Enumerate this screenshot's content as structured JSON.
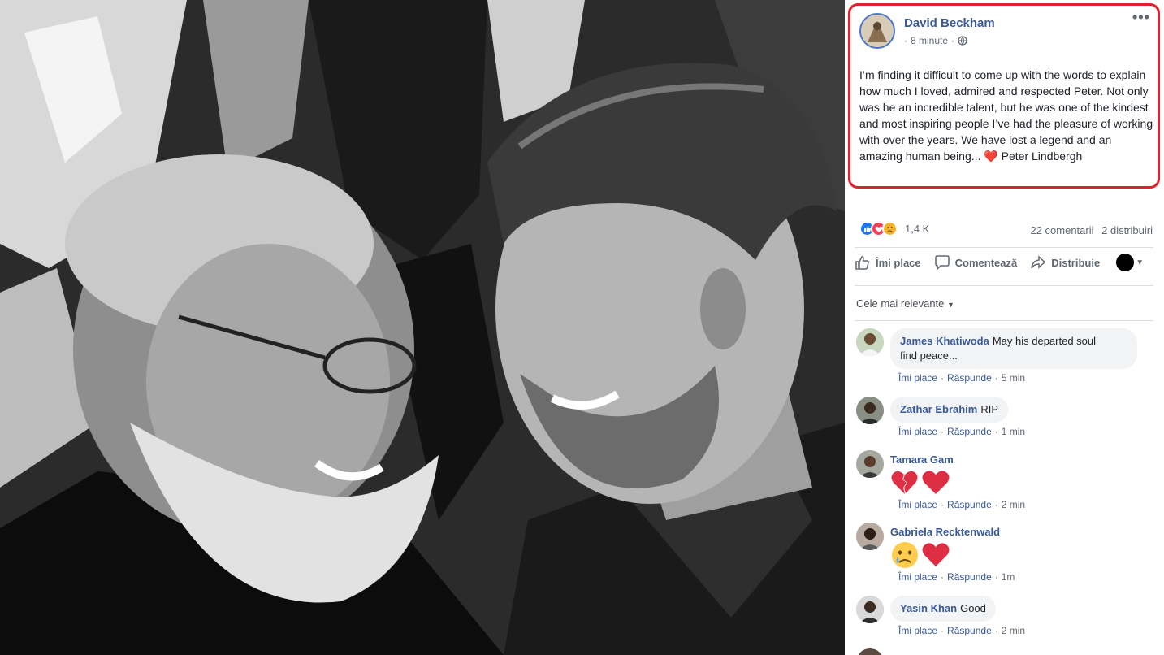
{
  "post": {
    "author": "David Beckham",
    "time": "8 minute",
    "dot": "·",
    "text_before_heart": "I’m finding it difficult to come up with the words to explain how much I loved, admired and respected Peter. Not only was he an incredible talent, but he was one of the kindest and most inspiring people I’ve had the pleasure of working with over the years. We have lost a legend and an amazing human being... ",
    "heart": "❤️",
    "text_after_heart": " Peter Lindbergh",
    "more_icon": "•••"
  },
  "reactions": {
    "count": "1,4 K",
    "comments": "22 comentarii",
    "shares": "2 distribuiri",
    "icons": [
      "like-icon",
      "love-icon",
      "sad-icon"
    ]
  },
  "actions": {
    "like": "Îmi place",
    "comment": "Comentează",
    "share": "Distribuie"
  },
  "sort_label": "Cele mai relevante",
  "comments": [
    {
      "name": "James Khatiwoda",
      "text": "May his departed soul",
      "text2": "find peace...",
      "like": "Îmi place",
      "reply": "Răspunde",
      "time": "5 min"
    },
    {
      "name": "Zathar Ebrahim",
      "text": "RIP",
      "like": "Îmi place",
      "reply": "Răspunde",
      "time": "1 min"
    },
    {
      "name": "Tamara Gam",
      "emojis": [
        "broken-heart-icon",
        "red-heart-icon"
      ],
      "like": "Îmi place",
      "reply": "Răspunde",
      "time": "2 min"
    },
    {
      "name": "Gabriela Recktenwald",
      "emojis": [
        "crying-face-icon",
        "red-heart-icon"
      ],
      "like": "Îmi place",
      "reply": "Răspunde",
      "time": "1m"
    },
    {
      "name": "Yasin Khan",
      "text": "Good",
      "like": "Îmi place",
      "reply": "Răspunde",
      "time": "2 min"
    }
  ],
  "colors": {
    "link": "#385898",
    "highlight_border": "#e0202a",
    "secondary_text": "#606770"
  }
}
